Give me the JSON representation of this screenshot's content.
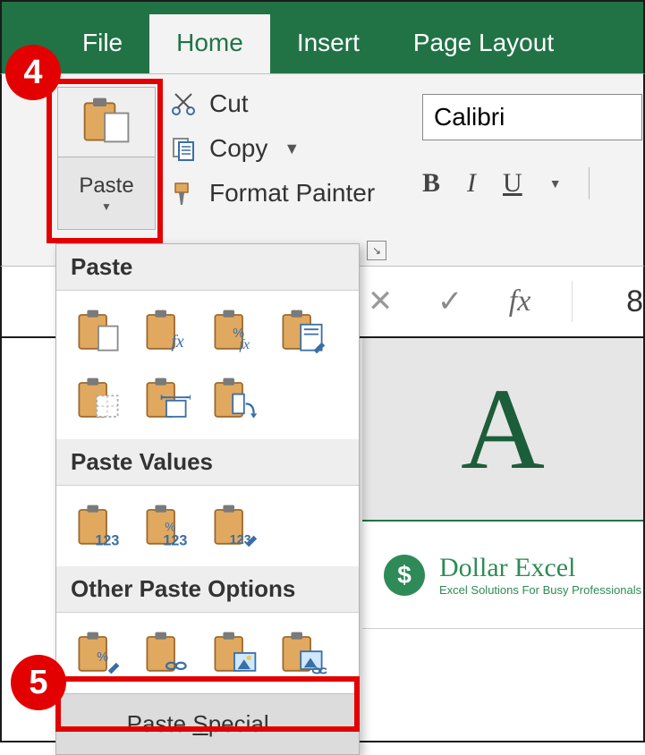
{
  "tabs": {
    "file": "File",
    "home": "Home",
    "insert": "Insert",
    "page_layout": "Page Layout"
  },
  "clipboard": {
    "paste": "Paste",
    "cut": "Cut",
    "copy": "Copy",
    "format_painter": "Format Painter"
  },
  "font": {
    "name": "Calibri",
    "bold": "B",
    "italic": "I",
    "underline": "U"
  },
  "formula_bar": {
    "cancel": "✕",
    "enter": "✓",
    "fx": "fx",
    "value": "8"
  },
  "sheet": {
    "col_a": "A",
    "brand_title": "Dollar Excel",
    "brand_sub": "Excel Solutions For Busy Professionals",
    "brand_symbol": "$"
  },
  "paste_menu": {
    "section_paste": "Paste",
    "section_values": "Paste Values",
    "section_other": "Other Paste Options",
    "special_prefix": "Paste ",
    "special_key": "S",
    "special_suffix": "pecial..."
  },
  "icon_text": {
    "fx": "fx",
    "pctfx": "%",
    "n123": "123",
    "pct": "%"
  },
  "callouts": {
    "c4": "4",
    "c5": "5"
  }
}
